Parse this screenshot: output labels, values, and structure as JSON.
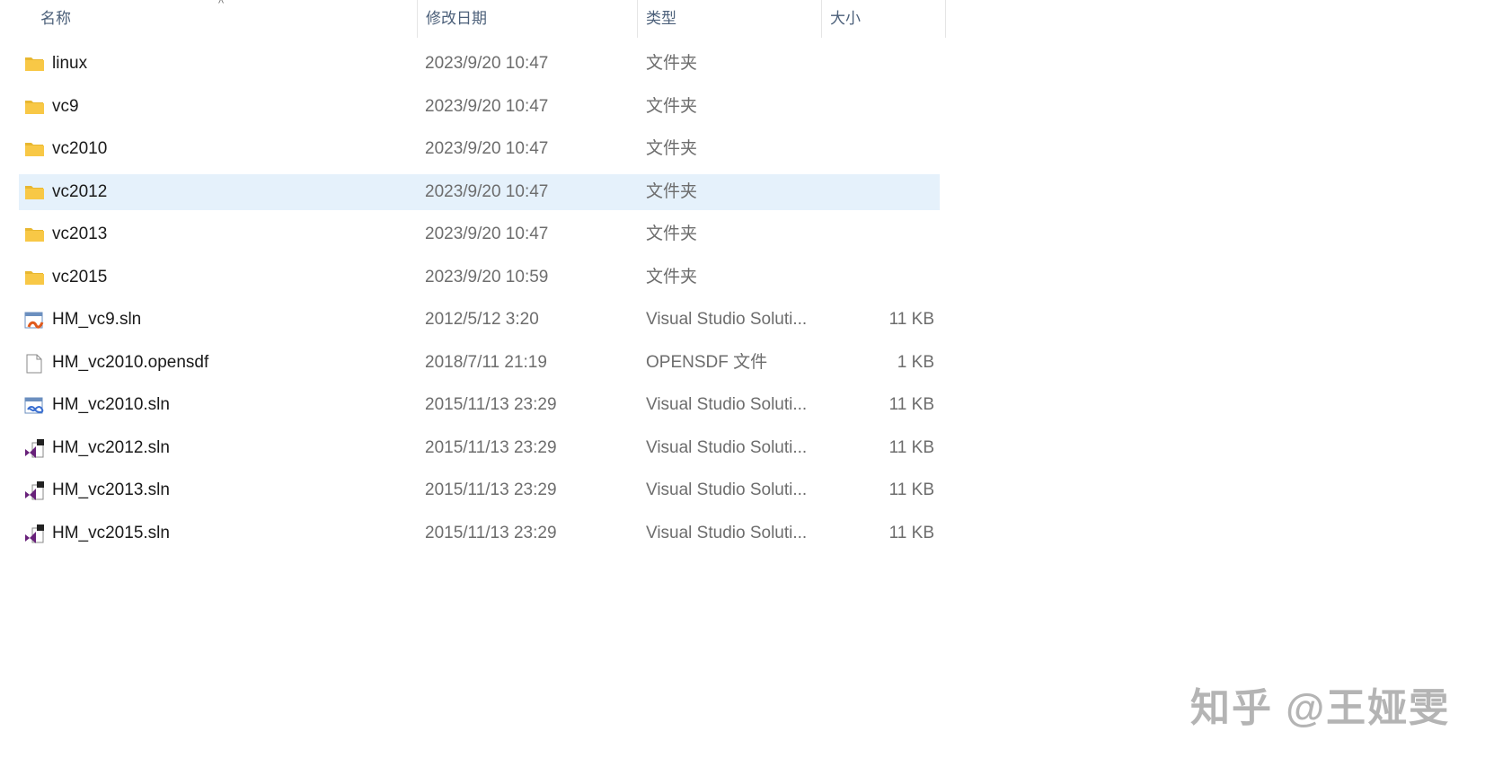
{
  "columns": {
    "name": "名称",
    "date": "修改日期",
    "type": "类型",
    "size": "大小"
  },
  "files": [
    {
      "name": "linux",
      "date": "2023/9/20 10:47",
      "type": "文件夹",
      "size": "",
      "icon": "folder-icon"
    },
    {
      "name": "vc9",
      "date": "2023/9/20 10:47",
      "type": "文件夹",
      "size": "",
      "icon": "folder-icon"
    },
    {
      "name": "vc2010",
      "date": "2023/9/20 10:47",
      "type": "文件夹",
      "size": "",
      "icon": "folder-icon"
    },
    {
      "name": "vc2012",
      "date": "2023/9/20 10:47",
      "type": "文件夹",
      "size": "",
      "icon": "folder-icon",
      "selected": true
    },
    {
      "name": "vc2013",
      "date": "2023/9/20 10:47",
      "type": "文件夹",
      "size": "",
      "icon": "folder-icon"
    },
    {
      "name": "vc2015",
      "date": "2023/9/20 10:59",
      "type": "文件夹",
      "size": "",
      "icon": "folder-icon"
    },
    {
      "name": "HM_vc9.sln",
      "date": "2012/5/12 3:20",
      "type": "Visual Studio Soluti...",
      "size": "11 KB",
      "icon": "vs2008-solution-icon"
    },
    {
      "name": "HM_vc2010.opensdf",
      "date": "2018/7/11 21:19",
      "type": "OPENSDF 文件",
      "size": "1 KB",
      "icon": "file-icon"
    },
    {
      "name": "HM_vc2010.sln",
      "date": "2015/11/13 23:29",
      "type": "Visual Studio Soluti...",
      "size": "11 KB",
      "icon": "vs2010-solution-icon"
    },
    {
      "name": "HM_vc2012.sln",
      "date": "2015/11/13 23:29",
      "type": "Visual Studio Soluti...",
      "size": "11 KB",
      "icon": "vs-solution-icon",
      "badge": "11"
    },
    {
      "name": "HM_vc2013.sln",
      "date": "2015/11/13 23:29",
      "type": "Visual Studio Soluti...",
      "size": "11 KB",
      "icon": "vs-solution-icon",
      "badge": "12"
    },
    {
      "name": "HM_vc2015.sln",
      "date": "2015/11/13 23:29",
      "type": "Visual Studio Soluti...",
      "size": "11 KB",
      "icon": "vs-solution-icon",
      "badge": "14"
    }
  ],
  "watermark": "知乎 @王娅雯",
  "colors": {
    "selection": "#e5f1fb",
    "folder": "#f8c846",
    "vs_purple": "#68217a"
  }
}
